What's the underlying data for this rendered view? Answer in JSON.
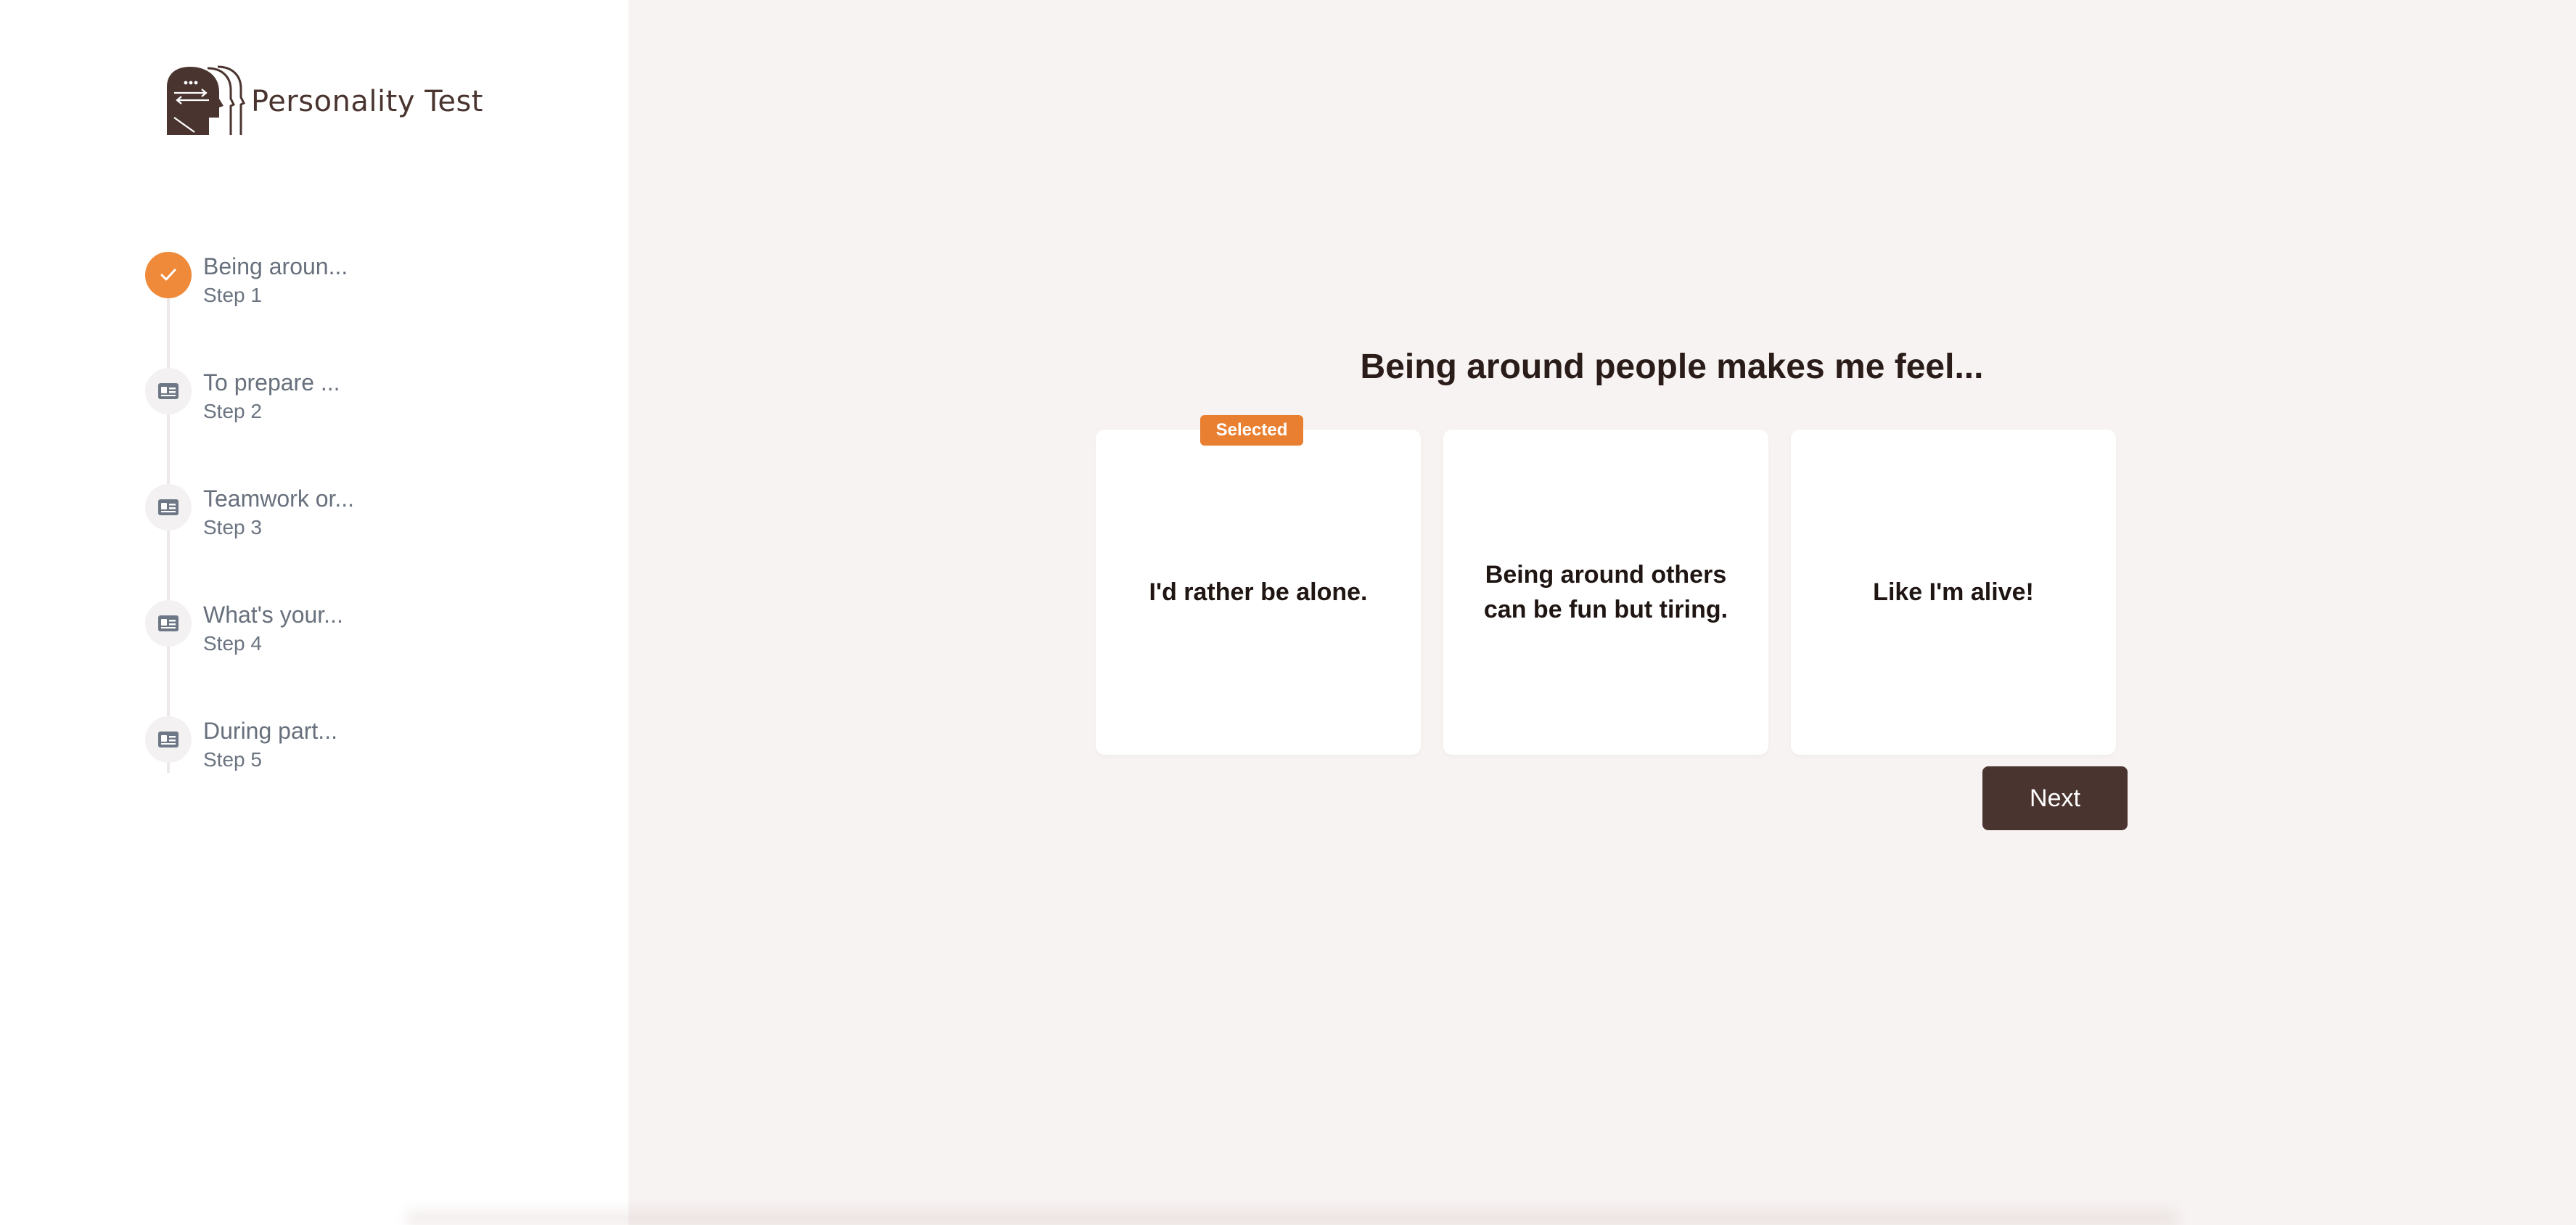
{
  "brand": {
    "name": "Personality Test",
    "icon": "head-profile-icon"
  },
  "steps": [
    {
      "title": "Being aroun...",
      "subtitle": "Step 1",
      "status": "completed",
      "icon": "check-icon"
    },
    {
      "title": "To prepare ...",
      "subtitle": "Step 2",
      "status": "pending",
      "icon": "id-card-icon"
    },
    {
      "title": "Teamwork or...",
      "subtitle": "Step 3",
      "status": "pending",
      "icon": "id-card-icon"
    },
    {
      "title": "What's your...",
      "subtitle": "Step 4",
      "status": "pending",
      "icon": "id-card-icon"
    },
    {
      "title": "During part...",
      "subtitle": "Step 5",
      "status": "pending",
      "icon": "id-card-icon"
    }
  ],
  "question": {
    "text": "Being around people makes me feel...",
    "options": [
      {
        "label": "I'd rather be alone.",
        "selected": true
      },
      {
        "label": "Being around others can be fun but tiring.",
        "selected": false
      },
      {
        "label": "Like I'm alive!",
        "selected": false
      }
    ],
    "selected_badge": "Selected"
  },
  "actions": {
    "next_label": "Next"
  },
  "colors": {
    "accent": "#ef8a3a",
    "brand_dark": "#4a3430",
    "background": "#f7f3f2"
  }
}
